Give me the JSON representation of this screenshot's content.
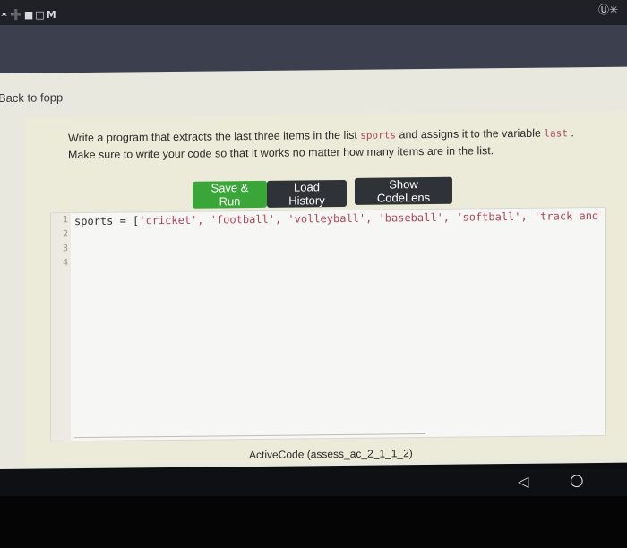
{
  "status_bar": {
    "left_icons": "✶➕■□M",
    "right_icons": "Ⓤ✳"
  },
  "back_link": "Back to fopp",
  "exercise": {
    "prompt_line1_part1": "Write a program that extracts the last three items in the list ",
    "prompt_code1": "sports",
    "prompt_line1_part2": " and assigns it to the variable ",
    "prompt_code2": "last",
    "prompt_line1_part3": " .",
    "prompt_line2": "Make sure to write your code so that it works no matter how many items are in the list.",
    "buttons": {
      "save_run": "Save & Run",
      "load_history": "Load History",
      "show_codelens": "Show CodeLens"
    },
    "code": {
      "line_numbers": [
        "1",
        "2",
        "3",
        "4"
      ],
      "line1_prefix": "sports = [",
      "line1_strings": "'cricket', 'football', 'volleyball', 'baseball', 'softball', 'track and"
    },
    "caption": "ActiveCode (assess_ac_2_1_1_2)"
  },
  "nav": {
    "back_icon": "◁",
    "home_icon": "○"
  }
}
